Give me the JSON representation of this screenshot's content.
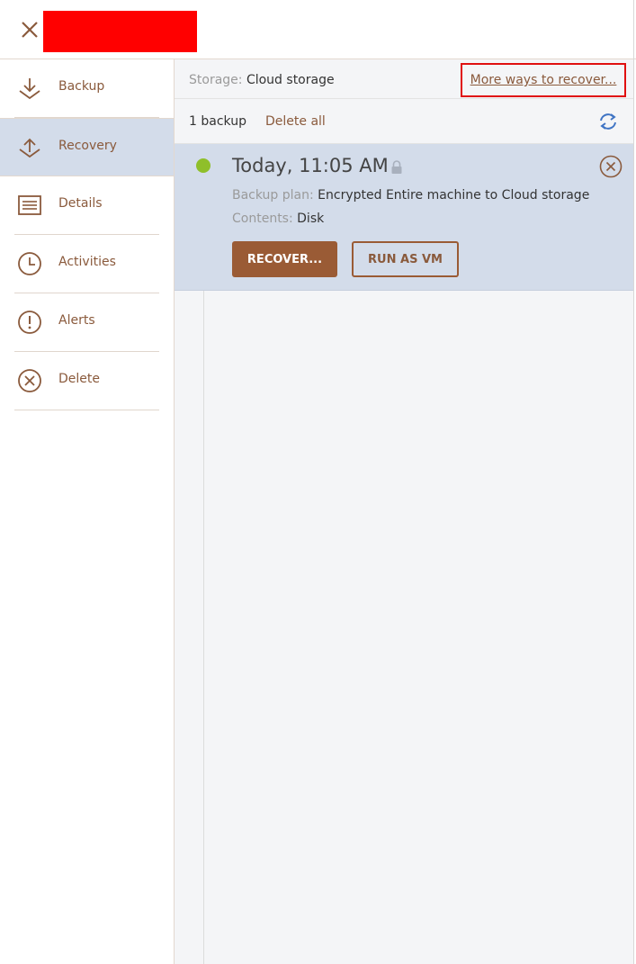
{
  "header": {
    "close_icon": "close-icon",
    "redacted_title": ""
  },
  "sidebar": {
    "items": [
      {
        "label": "Backup",
        "icon": "backup-download-icon"
      },
      {
        "label": "Recovery",
        "icon": "recovery-upload-icon",
        "active": true
      },
      {
        "label": "Details",
        "icon": "details-list-icon"
      },
      {
        "label": "Activities",
        "icon": "clock-icon"
      },
      {
        "label": "Alerts",
        "icon": "alert-exclamation-icon"
      },
      {
        "label": "Delete",
        "icon": "delete-circle-x-icon"
      }
    ]
  },
  "storage": {
    "label": "Storage:",
    "value": "Cloud storage",
    "more_link": "More ways to recover..."
  },
  "backups": {
    "count_text": "1 backup",
    "delete_all": "Delete all",
    "refresh_icon": "refresh-icon"
  },
  "backup_entry": {
    "title": "Today, 11:05 AM",
    "status_color": "#8fbf2a",
    "plan_label": "Backup plan:",
    "plan_value": "Encrypted Entire machine to Cloud storage",
    "contents_label": "Contents:",
    "contents_value": "Disk",
    "recover_button": "RECOVER...",
    "run_vm_button": "RUN AS VM"
  },
  "colors": {
    "accent_brown": "#9a5b35",
    "link_brown": "#8a5a3c",
    "active_bg": "#d3dcea",
    "highlight_red": "#e01010"
  }
}
